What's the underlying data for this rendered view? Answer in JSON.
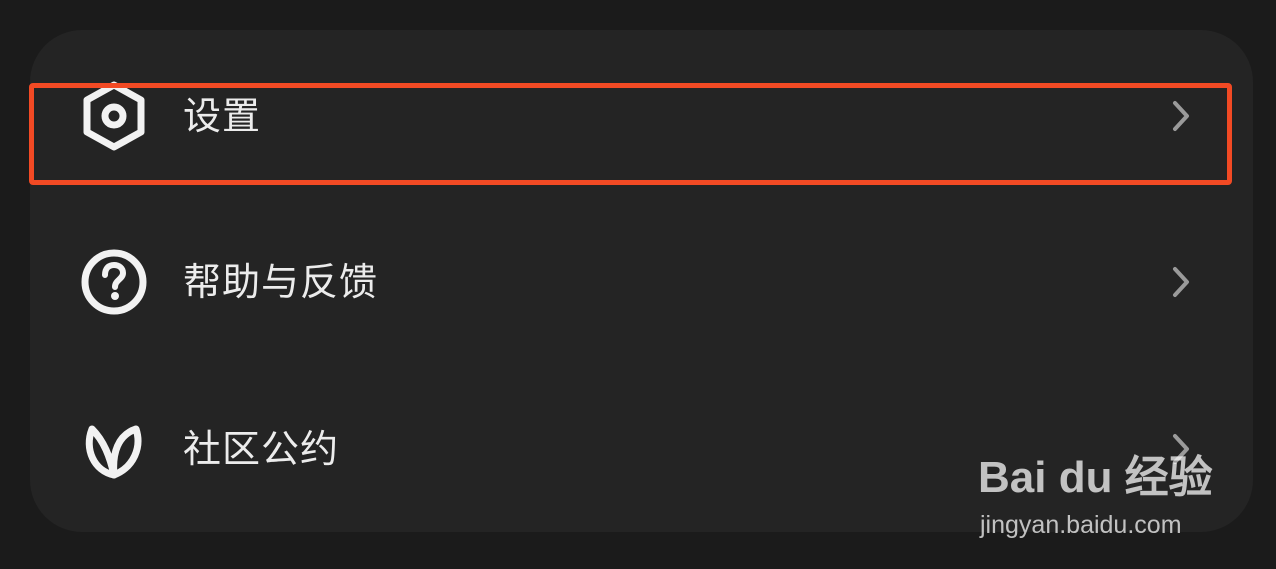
{
  "menu": {
    "items": [
      {
        "label": "设置",
        "icon": "settings-hexagon-icon",
        "highlighted": true
      },
      {
        "label": "帮助与反馈",
        "icon": "help-question-icon",
        "highlighted": false
      },
      {
        "label": "社区公约",
        "icon": "community-leaf-icon",
        "highlighted": false
      }
    ]
  },
  "colors": {
    "background": "#1b1b1b",
    "panel": "#242424",
    "text": "#ececec",
    "chevron": "#9a9a9a",
    "highlight_border": "#f24a24"
  },
  "watermark": {
    "brand": "Bai du 经验",
    "url": "jingyan.baidu.com"
  }
}
